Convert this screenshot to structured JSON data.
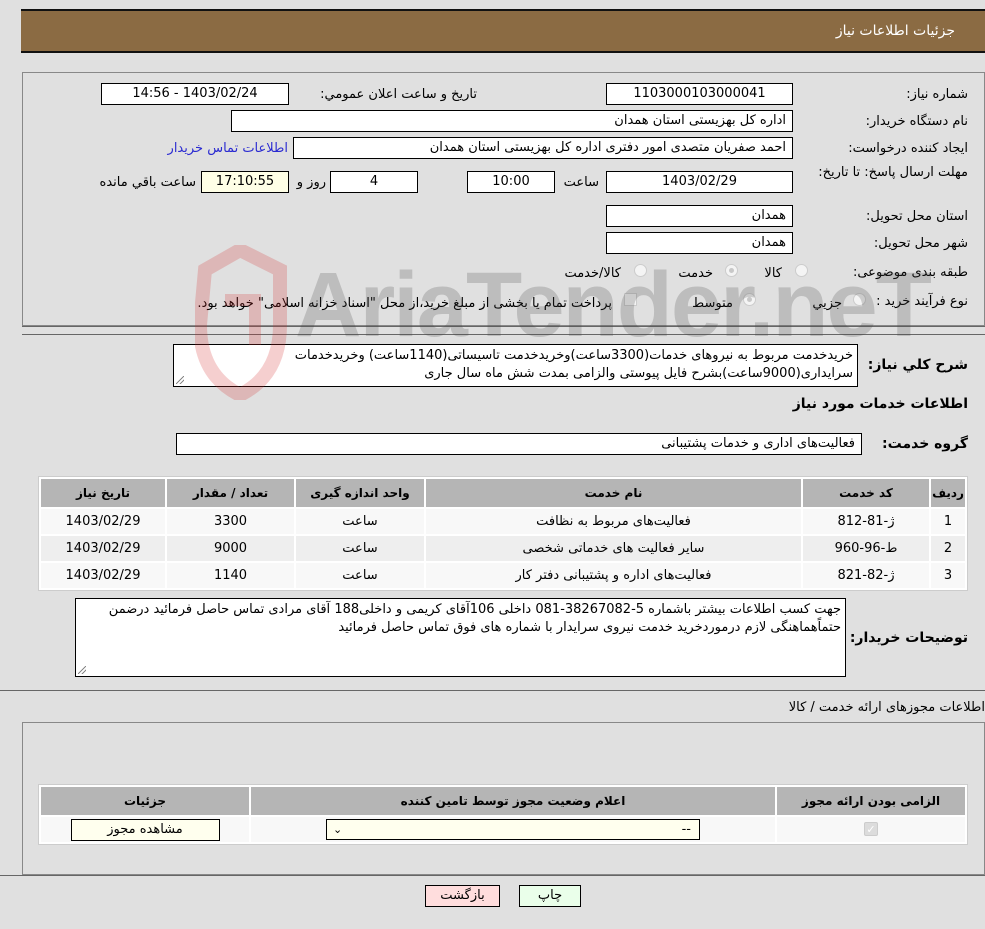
{
  "header": {
    "title": "جزئیات اطلاعات نیاز"
  },
  "form": {
    "need_number": {
      "label": "شماره نیاز:",
      "value": "1103000103000041"
    },
    "announce_datetime": {
      "label": "تاریخ و ساعت اعلان عمومي:",
      "value": "1403/02/24 - 14:56"
    },
    "buyer_org": {
      "label": "نام دستگاه خريدار:",
      "value": "اداره کل بهزیستی استان همدان"
    },
    "requester": {
      "label": "ايجاد کننده درخواست:",
      "value": "احمد صفریان متصدی امور دفتری اداره کل بهزیستی استان همدان"
    },
    "buyer_contact_link": "اطلاعات تماس خريدار",
    "deadline": {
      "label": "مهلت ارسال پاسخ: تا تاریخ:",
      "date": "1403/02/29",
      "time_label": "ساعت",
      "time": "10:00",
      "days": "4",
      "days_label": "روز و",
      "remaining": "17:10:55",
      "remaining_label": "ساعت باقي مانده"
    },
    "province": {
      "label": "استان محل تحويل:",
      "value": "همدان"
    },
    "city": {
      "label": "شهر محل تحويل:",
      "value": "همدان"
    },
    "category": {
      "label": "طبقه بندی موضوعی:",
      "options": [
        "کالا",
        "خدمت",
        "کالا/خدمت"
      ],
      "selected": "خدمت"
    },
    "purchase_type": {
      "label": "نوع فرآيند خريد :",
      "options": [
        "جزيي",
        "متوسط"
      ],
      "selected": "متوسط",
      "treasury_checkbox_label": "پرداخت تمام یا بخشی از مبلغ خرید،از محل \"اسناد خزانه اسلامی\" خواهد بود.",
      "treasury_checked": false
    }
  },
  "description": {
    "label": "شرح کلي نياز:",
    "value": "خریدخدمت مربوط به نیروهای خدمات(3300ساعت)وخریدخدمت تاسیساتی(1140ساعت) وخریدخدمات سرایداری(9000ساعت)بشرح فایل پیوستی والزامی بمدت شش ماه سال جاری"
  },
  "services_section": {
    "title": "اطلاعات خدمات مورد نياز",
    "group_label": "گروه خدمت:",
    "group_value": "فعالیت‌های اداری و خدمات پشتیبانی",
    "table": {
      "headers": [
        "رديف",
        "کد خدمت",
        "نام خدمت",
        "واحد اندازه گيری",
        "تعداد / مقدار",
        "تاريخ نياز"
      ],
      "rows": [
        [
          "1",
          "ژ-81-812",
          "فعالیت‌های مربوط به نظافت",
          "ساعت",
          "3300",
          "1403/02/29"
        ],
        [
          "2",
          "ط-96-960",
          "سایر فعالیت های خدماتی شخصی",
          "ساعت",
          "9000",
          "1403/02/29"
        ],
        [
          "3",
          "ژ-82-821",
          "فعالیت‌های اداره و پشتیبانی دفتر کار",
          "ساعت",
          "1140",
          "1403/02/29"
        ]
      ]
    }
  },
  "buyer_notes": {
    "label": "توضيحات خريدار:",
    "value": "جهت کسب اطلاعات بیشتر باشماره 5-38267082-081 داخلی 106آقای کریمی و داخلی188 آقای مرادی  تماس حاصل فرمائید درضمن حتماًهماهنگی لازم درموردخرید خدمت نیروی سرایدار  با شماره های فوق تماس حاصل فرمائید"
  },
  "permits_section": {
    "title": "اطلاعات مجوزهای ارائه خدمت / کالا",
    "table": {
      "headers": [
        "الزامی بودن ارائه مجوز",
        "اعلام وضعیت مجوز توسط تامین کننده",
        "جزئیات"
      ],
      "row": {
        "required_checked": true,
        "status_select_value": "--",
        "details_button": "مشاهده مجوز"
      }
    }
  },
  "actions": {
    "print": "چاپ",
    "back": "بازگشت"
  },
  "watermark": {
    "text": "AriaTender.neT"
  },
  "colors": {
    "header_bg": "#8b6b43",
    "link": "#2b2bd1",
    "print_btn": "#eaffea",
    "back_btn": "#ffdddd",
    "yellow_field": "#ffffe6"
  }
}
